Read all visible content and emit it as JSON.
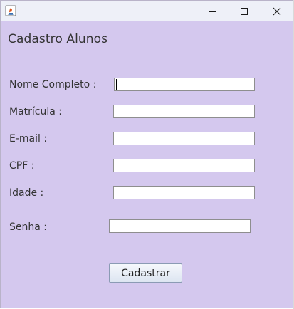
{
  "window": {
    "title": "",
    "controls": {
      "minimize_icon": "minimize-icon",
      "maximize_icon": "maximize-icon",
      "close_icon": "close-icon"
    },
    "app_icon": "java-icon"
  },
  "form": {
    "title": "Cadastro Alunos",
    "fields": [
      {
        "label": "Nome Completo :",
        "value": ""
      },
      {
        "label": "Matrícula :",
        "value": ""
      },
      {
        "label": "E-mail :",
        "value": ""
      },
      {
        "label": "CPF :",
        "value": ""
      },
      {
        "label": "Idade :",
        "value": ""
      },
      {
        "label": "Senha :",
        "value": ""
      }
    ],
    "submit_label": "Cadastrar"
  },
  "colors": {
    "form_background": "#d4c8ee",
    "titlebar_background": "#eef0f8"
  }
}
